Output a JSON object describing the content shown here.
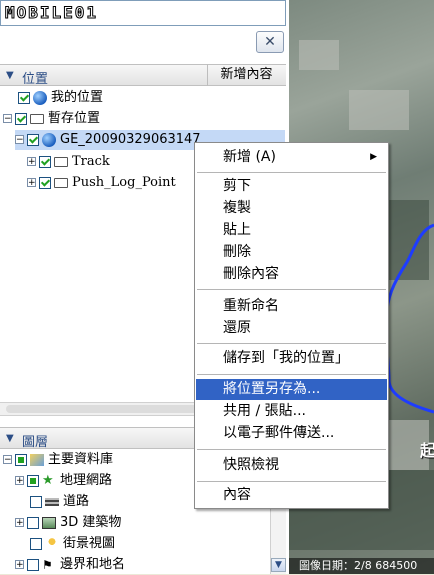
{
  "search": {
    "logo_text": "MOBILE01"
  },
  "places": {
    "header": "位置",
    "add_content": "新增內容",
    "items": [
      {
        "label": "我的位置"
      },
      {
        "label": "暫存位置"
      },
      {
        "label": "GE_20090329063147"
      },
      {
        "label": "Track"
      },
      {
        "label": "Push_Log_Point"
      }
    ]
  },
  "layers": {
    "header": "圖層",
    "items": [
      {
        "label": "主要資料庫"
      },
      {
        "label": "地理網路"
      },
      {
        "label": "道路"
      },
      {
        "label": "3D 建築物"
      },
      {
        "label": "街景視圖"
      },
      {
        "label": "邊界和地名"
      }
    ]
  },
  "context_menu": {
    "items": [
      {
        "label": "新增 (A)"
      },
      {
        "label": "剪下"
      },
      {
        "label": "複製"
      },
      {
        "label": "貼上"
      },
      {
        "label": "刪除"
      },
      {
        "label": "刪除內容"
      },
      {
        "label": "重新命名"
      },
      {
        "label": "還原"
      },
      {
        "label": "儲存到「我的位置」"
      },
      {
        "label": "將位置另存為..."
      },
      {
        "label": "共用 / 張貼..."
      },
      {
        "label": "以電子郵件傳送..."
      },
      {
        "label": "快照檢視"
      },
      {
        "label": "內容"
      }
    ]
  },
  "map": {
    "status_text": "圖像日期：2/8 684500",
    "overlay_text": "起"
  },
  "colors": {
    "highlight": "#3163c5",
    "track_line": "#1e3cff",
    "header_text": "#2c4e86"
  }
}
